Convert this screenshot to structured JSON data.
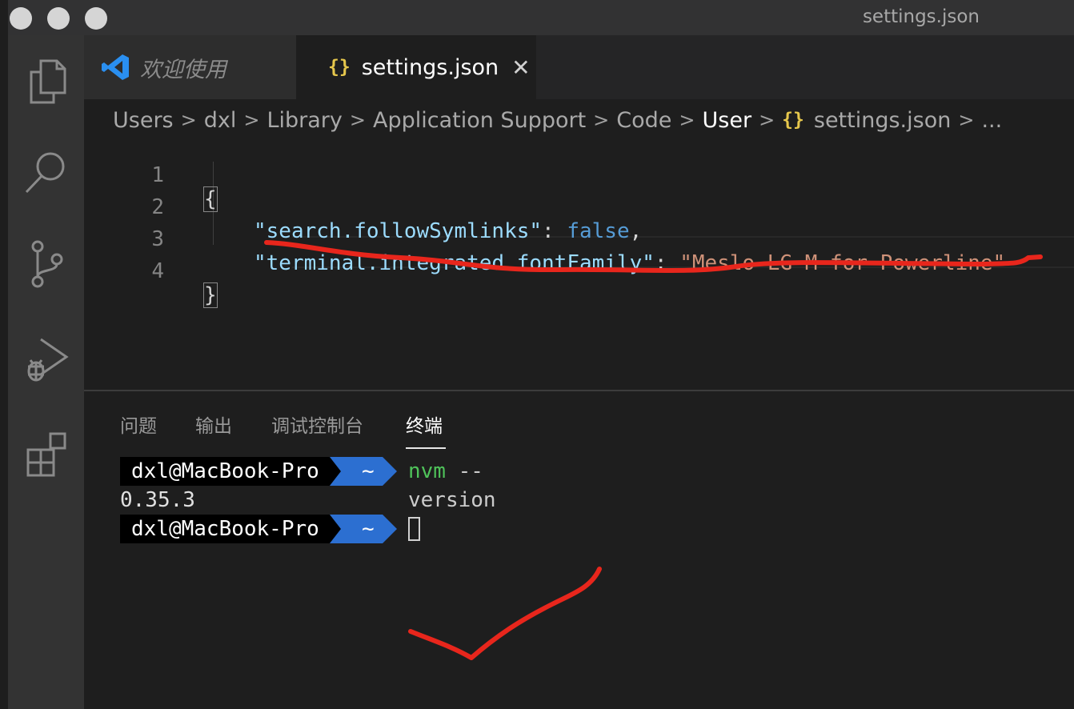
{
  "window": {
    "title": "settings.json"
  },
  "activity_bar": {
    "icons": [
      "files-icon",
      "search-icon",
      "source-control-icon",
      "run-debug-icon",
      "extensions-icon"
    ]
  },
  "tabs": [
    {
      "label": "欢迎使用",
      "icon": "vscode-logo-icon",
      "active": false
    },
    {
      "label": "settings.json",
      "icon": "{}",
      "active": true,
      "close": "✕"
    }
  ],
  "breadcrumb": {
    "items": [
      "Users",
      "dxl",
      "Library",
      "Application Support",
      "Code",
      "User"
    ],
    "file_icon": "{}",
    "file": "settings.json",
    "more": "...",
    "separator": ">"
  },
  "editor": {
    "line_numbers": [
      "1",
      "2",
      "3",
      "4"
    ],
    "lines": {
      "open": "{",
      "l2_key": "\"search.followSymlinks\"",
      "l2_colon": ": ",
      "l2_value": "false",
      "l2_comma": ",",
      "l3_key": "\"terminal.integrated.fontFamily\"",
      "l3_colon": ": ",
      "l3_value": "\"Meslo LG M for Powerline\"",
      "close": "}"
    },
    "colors": {
      "key": "#9cdcfe",
      "keyword": "#569cd6",
      "string": "#ce9178"
    }
  },
  "panel": {
    "tabs": [
      "问题",
      "输出",
      "调试控制台",
      "终端"
    ],
    "active_tab": "终端"
  },
  "terminal": {
    "prompt_user": "dxl@MacBook-Pro",
    "prompt_dir": "~",
    "cmd_name": "nvm",
    "cmd_args": " --version",
    "output": "0.35.3",
    "colors": {
      "prompt_bg": "#000000",
      "dir_bg": "#2c6fd1",
      "command": "#4fc35a"
    }
  },
  "annotations": {
    "color": "#e8261c",
    "marks": [
      "underline",
      "checkmark"
    ]
  }
}
